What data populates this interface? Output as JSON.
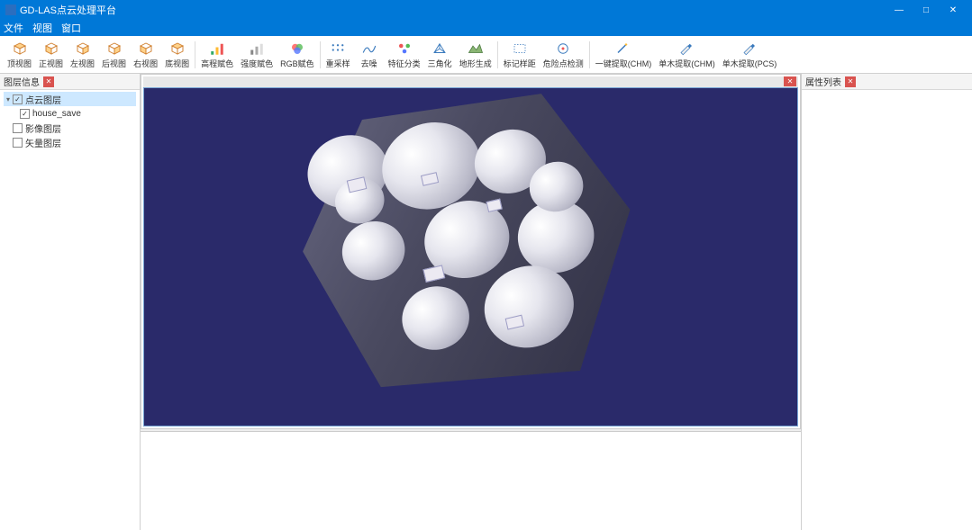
{
  "window": {
    "title": "GD-LAS点云处理平台",
    "btn_min": "—",
    "btn_max": "□",
    "btn_close": "✕"
  },
  "menu": {
    "file": "文件",
    "view": "视图",
    "window": "窗口"
  },
  "toolbar": {
    "views": {
      "top": "顶视图",
      "front": "正视图",
      "left": "左视图",
      "back": "后视图",
      "right": "右视图",
      "bottom": "底视图"
    },
    "color": {
      "elev": "高程赋色",
      "intensity": "强度赋色",
      "rgb": "RGB赋色"
    },
    "proc": {
      "resample": "重采样",
      "denoise": "去噪",
      "classify": "特征分类",
      "tri": "三角化",
      "terrain": "地形生成"
    },
    "mark": {
      "marksample": "标记样距",
      "danger": "危险点检测"
    },
    "extract": {
      "onekey": "一键提取(CHM)",
      "single_chm": "单木提取(CHM)",
      "single_pcs": "单木提取(PCS)"
    }
  },
  "panels": {
    "layers_title": "图层信息",
    "attrs_title": "属性列表",
    "close_x": "✕"
  },
  "tree": {
    "root_pc": "点云图层",
    "item1": "house_save",
    "root_img": "影像图层",
    "root_vec": "矢量图层"
  },
  "viewport": {
    "tab_close": "✕"
  }
}
